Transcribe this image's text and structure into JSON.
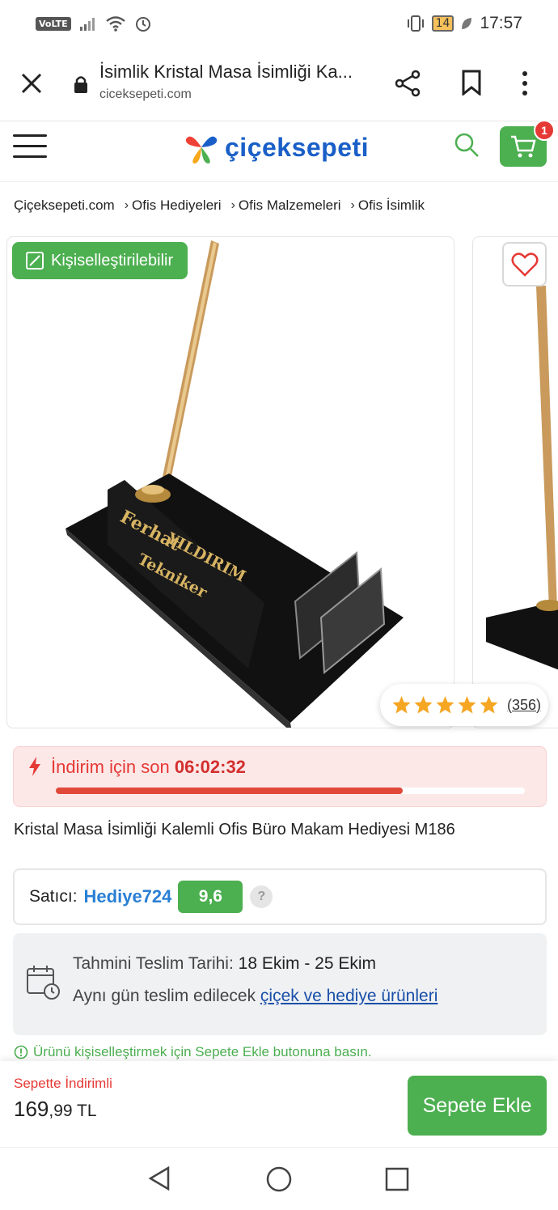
{
  "status_bar": {
    "network": "VoLTE",
    "battery": "14",
    "time": "17:57"
  },
  "browser": {
    "title": "İsimlik Kristal Masa İsimliği Ka...",
    "url": "ciceksepeti.com"
  },
  "site": {
    "logo": "çiçeksepeti",
    "cart_count": "1"
  },
  "breadcrumb": [
    "Çiçeksepeti.com",
    "Ofis Hediyeleri",
    "Ofis Malzemeleri",
    "Ofis İsimlik"
  ],
  "product": {
    "badge": "Kişiselleştirilebilir",
    "rating_count": "(356)",
    "rating_stars": 5,
    "image_text": [
      "Ferhat",
      "YILDIRIM",
      "Tekniker"
    ],
    "title": "Kristal Masa İsimliği Kalemli Ofis Büro Makam Hediyesi M186"
  },
  "countdown": {
    "label": "İndirim için son",
    "time": "06:02:32",
    "progress": 0.74
  },
  "seller": {
    "label": "Satıcı:",
    "name": "Hediye724",
    "score": "9,6",
    "help": "?"
  },
  "delivery": {
    "label": "Tahmini Teslim Tarihi:",
    "dates": "18 Ekim - 25 Ekim",
    "line2": "Aynı gün teslim edilecek",
    "link": "çiçek ve hediye ürünleri"
  },
  "note": "Ürünü kişiselleştirmek için Sepete Ekle butonuna basın.",
  "buy": {
    "discount_label": "Sepette İndirimli",
    "price_main": "169",
    "price_decimals": ",99 TL",
    "button": "Sepete Ekle"
  },
  "colors": {
    "green": "#4caf50",
    "red": "#e53935",
    "blue": "#1a5fc8"
  },
  "icons": [
    "close-icon",
    "lock-icon",
    "share-icon",
    "bookmark-icon",
    "more-icon",
    "menu-icon",
    "search-icon",
    "cart-icon",
    "edit-icon",
    "heart-icon",
    "star-icon",
    "bolt-icon",
    "calendar-icon",
    "info-icon",
    "back-icon",
    "home-icon",
    "recent-icon"
  ]
}
